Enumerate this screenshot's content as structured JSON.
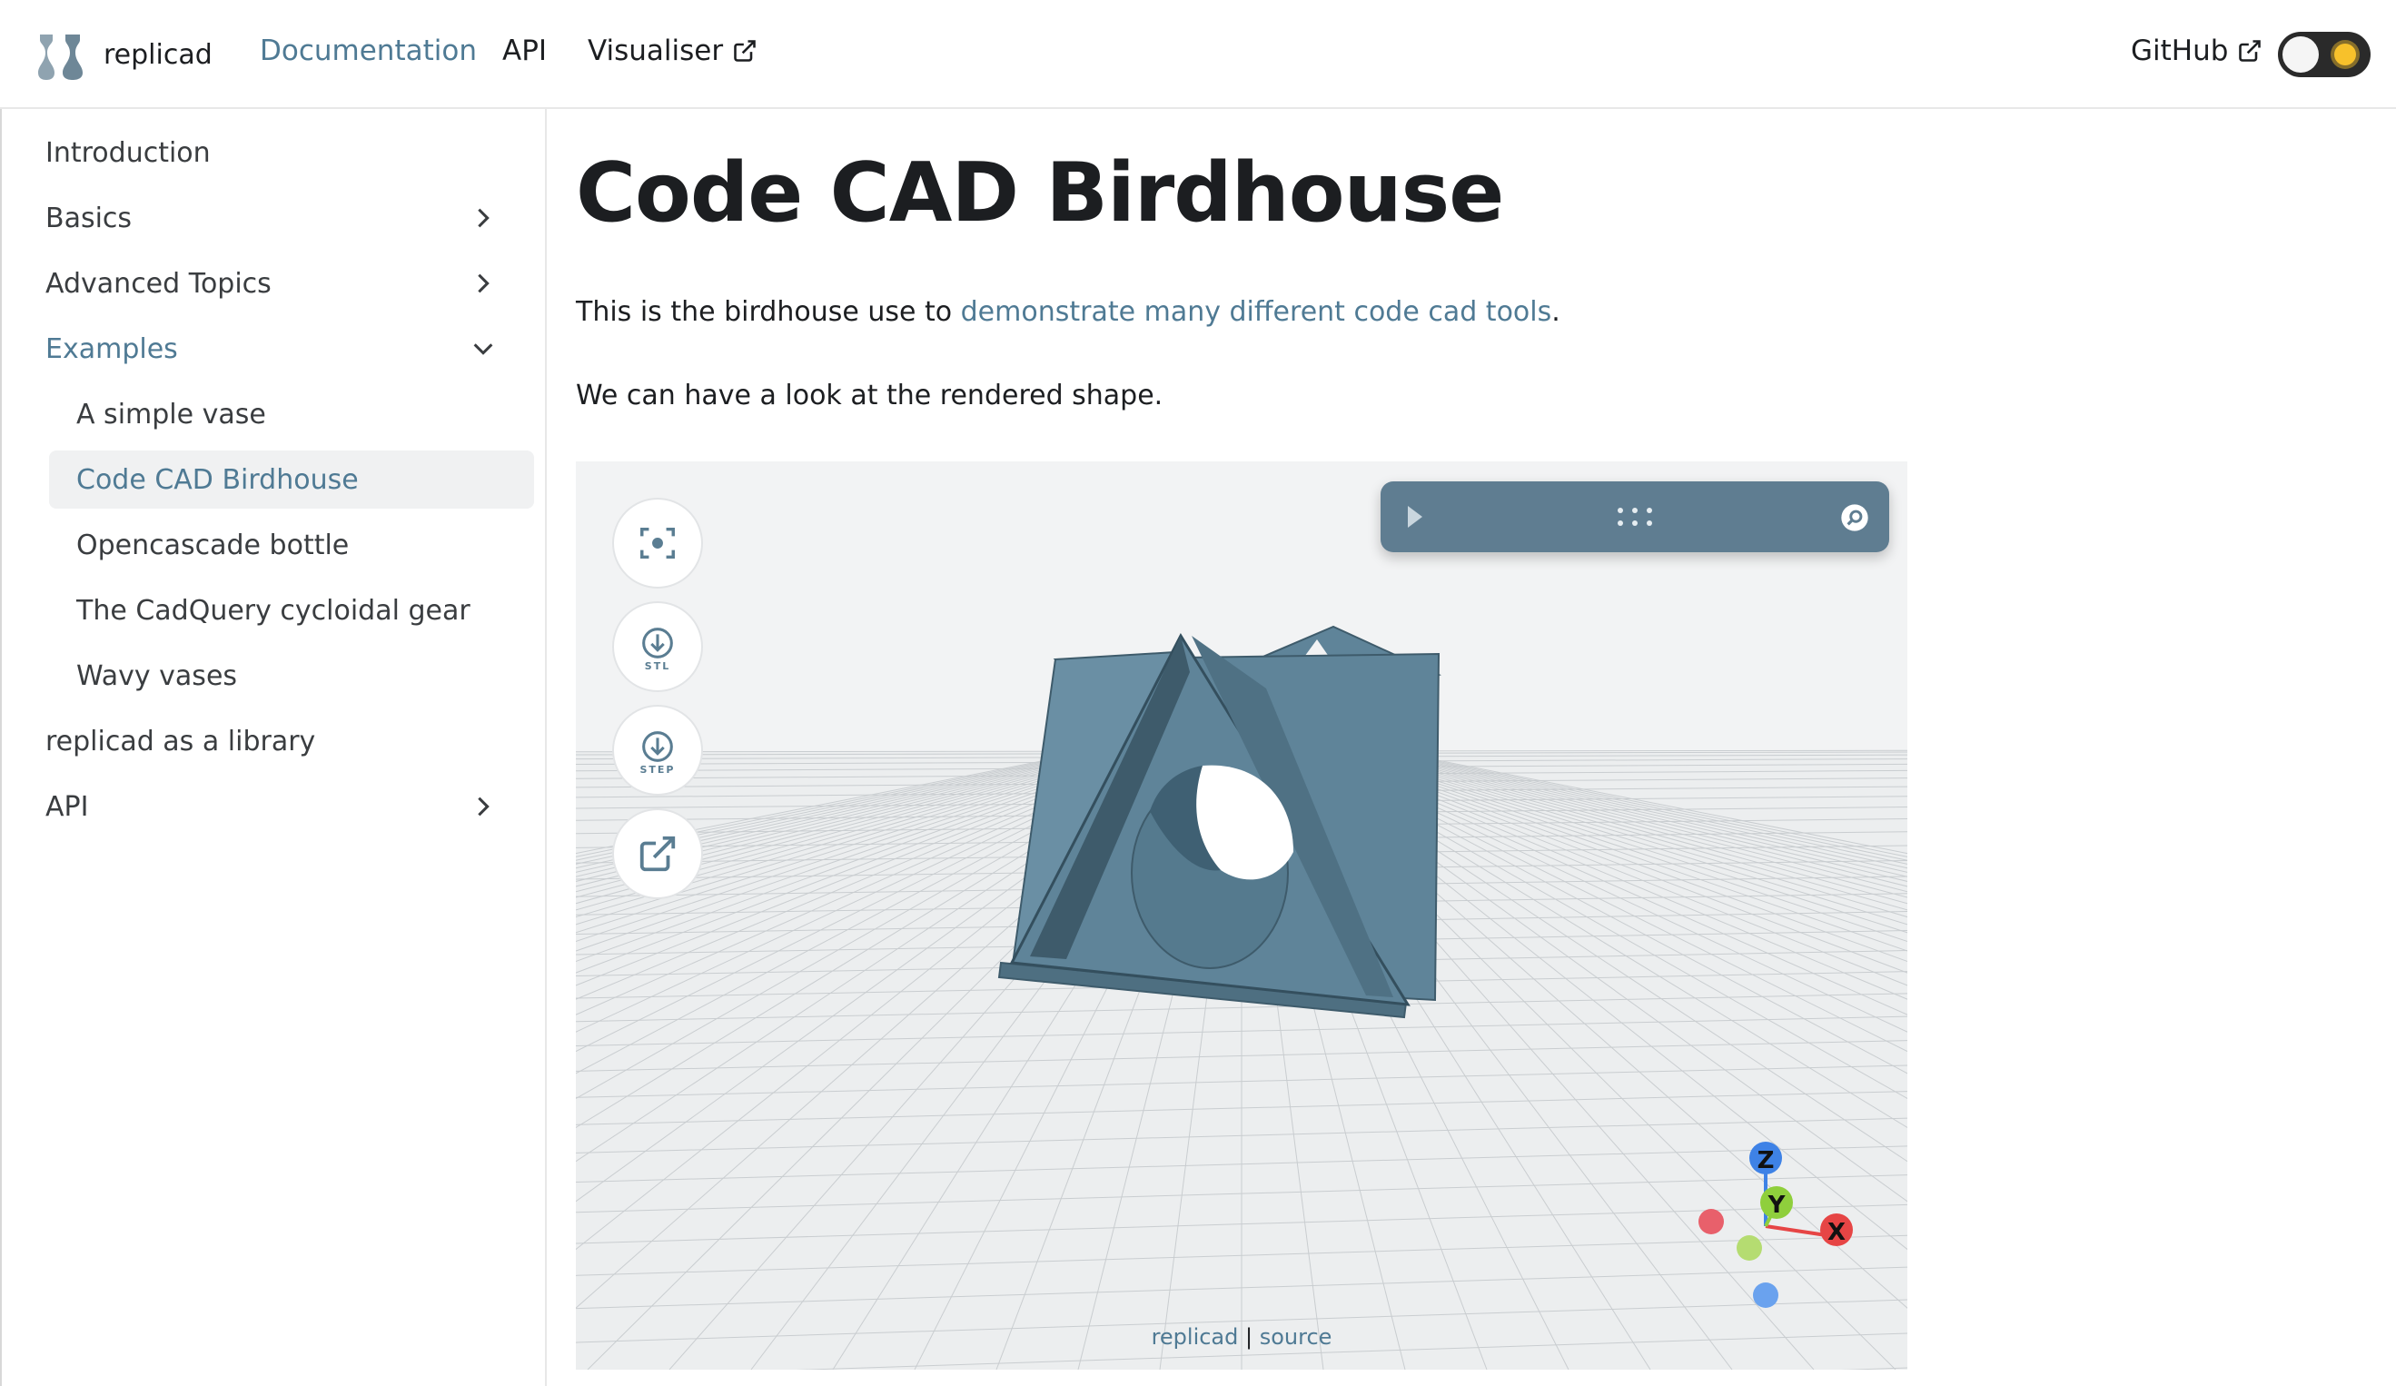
{
  "navbar": {
    "brand": "replicad",
    "links": [
      "Documentation",
      "API",
      "Visualiser"
    ],
    "github": "GitHub"
  },
  "sidebar": {
    "items": [
      {
        "label": "Introduction"
      },
      {
        "label": "Basics"
      },
      {
        "label": "Advanced Topics"
      },
      {
        "label": "Examples"
      },
      {
        "label": "A simple vase"
      },
      {
        "label": "Code CAD Birdhouse"
      },
      {
        "label": "Opencascade bottle"
      },
      {
        "label": "The CadQuery cycloidal gear"
      },
      {
        "label": "Wavy vases"
      },
      {
        "label": "replicad as a library"
      },
      {
        "label": "API"
      }
    ]
  },
  "main": {
    "title": "Code CAD Birdhouse",
    "intro_before": "This is the birdhouse use to ",
    "intro_link": "demonstrate many different code cad tools",
    "intro_after": ".",
    "rendered_text": "We can have a look at the rendered shape."
  },
  "viewer": {
    "stl_label": "STL",
    "step_label": "STEP",
    "axes": {
      "z": "Z",
      "y": "Y",
      "x": "X"
    },
    "credit_link1": "replicad",
    "credit_sep": " | ",
    "credit_link2": "source"
  },
  "colors": {
    "accent": "#4f7a94",
    "model": "#5f8499",
    "axis_x": "#e64545",
    "axis_y": "#8fcf3c",
    "axis_z": "#3e82e6"
  }
}
